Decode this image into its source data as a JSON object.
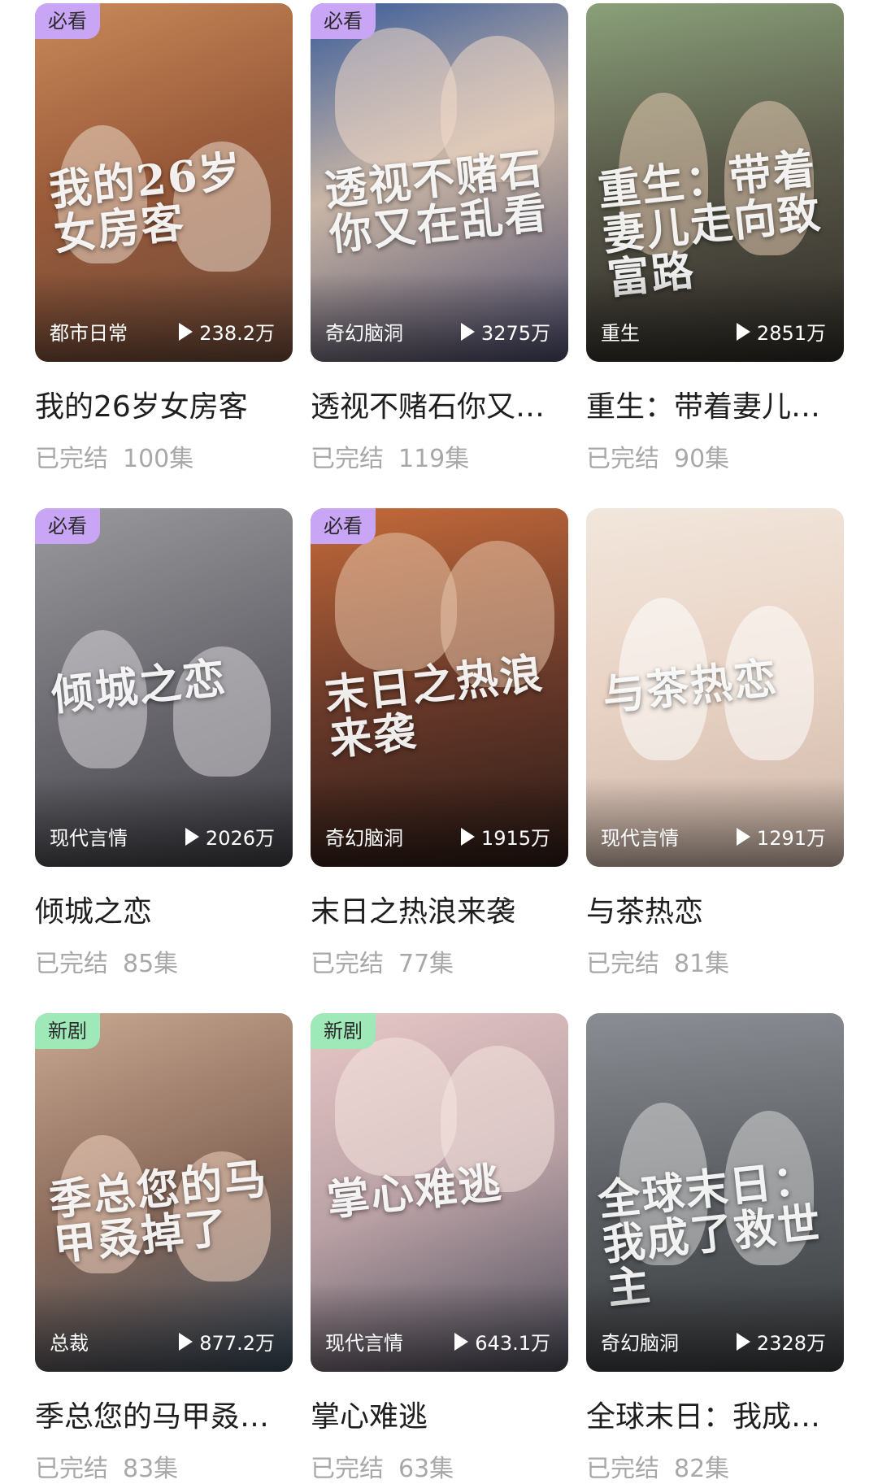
{
  "cards": [
    {
      "badge": "必看",
      "badge_color": "#c9a6f5",
      "art_title": "我的26岁女房客",
      "category": "都市日常",
      "plays": "238.2万",
      "title": "我的26岁女房客",
      "status": "已完结",
      "episodes": "100集",
      "bg": "linear-gradient(160deg,#c98a5a 0%,#9a5b3a 45%,#6e4a3a 100%)",
      "fig": "#e9d7c6"
    },
    {
      "badge": "必看",
      "badge_color": "#c9a6f5",
      "art_title": "透视不赌石你又在乱看",
      "category": "奇幻脑洞",
      "plays": "3275万",
      "title": "透视不赌石你又…",
      "status": "已完结",
      "episodes": "119集",
      "bg": "linear-gradient(160deg,#3a5c9a 0%,#c9b6a6 45%,#4a4a6a 100%)",
      "fig": "#f0d8c8"
    },
    {
      "badge": "",
      "badge_color": "",
      "art_title": "重生：带着妻儿走向致富路",
      "category": "重生",
      "plays": "2851万",
      "title": "重生：带着妻儿…",
      "status": "已完结",
      "episodes": "90集",
      "bg": "linear-gradient(170deg,#8aa07a 0%,#5a5a4a 45%,#2e2a26 100%)",
      "fig": "#e2c8b0"
    },
    {
      "badge": "必看",
      "badge_color": "#c9a6f5",
      "art_title": "倾城之恋",
      "category": "现代言情",
      "plays": "2026万",
      "title": "倾城之恋",
      "status": "已完结",
      "episodes": "85集",
      "bg": "linear-gradient(160deg,#9a9a9e 0%,#6a6a70 50%,#3e3e44 100%)",
      "fig": "#d8d4d8"
    },
    {
      "badge": "必看",
      "badge_color": "#c9a6f5",
      "art_title": "末日之热浪来袭",
      "category": "奇幻脑洞",
      "plays": "1915万",
      "title": "末日之热浪来袭",
      "status": "已完结",
      "episodes": "77集",
      "bg": "linear-gradient(170deg,#c46a3a 0%,#6a3a2a 50%,#2a1a16 100%)",
      "fig": "#e6c2a8"
    },
    {
      "badge": "",
      "badge_color": "",
      "art_title": "与茶热恋",
      "category": "现代言情",
      "plays": "1291万",
      "title": "与茶热恋",
      "status": "已完结",
      "episodes": "81集",
      "bg": "linear-gradient(170deg,#f2e6dc 0%,#e8d2c4 50%,#cdb6a8 100%)",
      "fig": "#ffffff"
    },
    {
      "badge": "新剧",
      "badge_color": "#9fe8b8",
      "art_title": "季总您的马甲叒掉了",
      "category": "总裁",
      "plays": "877.2万",
      "title": "季总您的马甲叒…",
      "status": "已完结",
      "episodes": "83集",
      "bg": "linear-gradient(160deg,#c8a890 0%,#8a6a5a 50%,#3a4a5a 100%)",
      "fig": "#f0d2c0"
    },
    {
      "badge": "新剧",
      "badge_color": "#9fe8b8",
      "art_title": "掌心难逃",
      "category": "现代言情",
      "plays": "643.1万",
      "title": "掌心难逃",
      "status": "已完结",
      "episodes": "63集",
      "bg": "linear-gradient(160deg,#e8c8c8 0%,#b8a0a4 50%,#4a4a58 100%)",
      "fig": "#f6e6e0"
    },
    {
      "badge": "",
      "badge_color": "",
      "art_title": "全球末日：我成了救世主",
      "category": "奇幻脑洞",
      "plays": "2328万",
      "title": "全球末日：我成…",
      "status": "已完结",
      "episodes": "82集",
      "bg": "linear-gradient(175deg,#8a8e94 0%,#5a5e62 50%,#3a3c3e 100%)",
      "fig": "#d6d6d6"
    }
  ]
}
